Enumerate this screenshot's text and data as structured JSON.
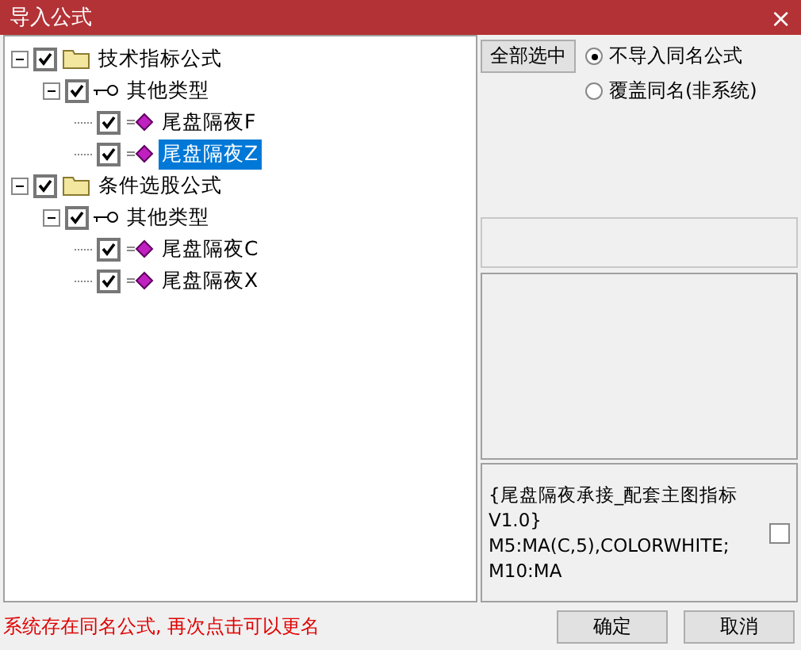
{
  "window": {
    "title": "导入公式",
    "close": "×"
  },
  "tree": [
    {
      "label": "技术指标公式",
      "kind": "folder",
      "checked": true,
      "expanded": true,
      "selected": false,
      "children": [
        {
          "label": "其他类型",
          "kind": "key",
          "checked": true,
          "expanded": true,
          "selected": false,
          "children": [
            {
              "label": "尾盘隔夜F",
              "kind": "formula",
              "checked": true,
              "selected": false
            },
            {
              "label": "尾盘隔夜Z",
              "kind": "formula",
              "checked": true,
              "selected": true
            }
          ]
        }
      ]
    },
    {
      "label": "条件选股公式",
      "kind": "folder",
      "checked": true,
      "expanded": true,
      "selected": false,
      "children": [
        {
          "label": "其他类型",
          "kind": "key",
          "checked": true,
          "expanded": true,
          "selected": false,
          "children": [
            {
              "label": "尾盘隔夜C",
              "kind": "formula",
              "checked": true,
              "selected": false
            },
            {
              "label": "尾盘隔夜X",
              "kind": "formula",
              "checked": true,
              "selected": false
            }
          ]
        }
      ]
    }
  ],
  "select_all": "全部选中",
  "options": [
    {
      "label": "不导入同名公式",
      "selected": true
    },
    {
      "label": "覆盖同名(非系统)",
      "selected": false
    }
  ],
  "preview": {
    "lines": [
      "{尾盘隔夜承接_配套主图指标",
      "V1.0}",
      "M5:MA(C,5),COLORWHITE;",
      "M10:MA"
    ],
    "checked": false
  },
  "status": "系统存在同名公式, 再次点击可以更名",
  "buttons": [
    "确定",
    "取消"
  ]
}
